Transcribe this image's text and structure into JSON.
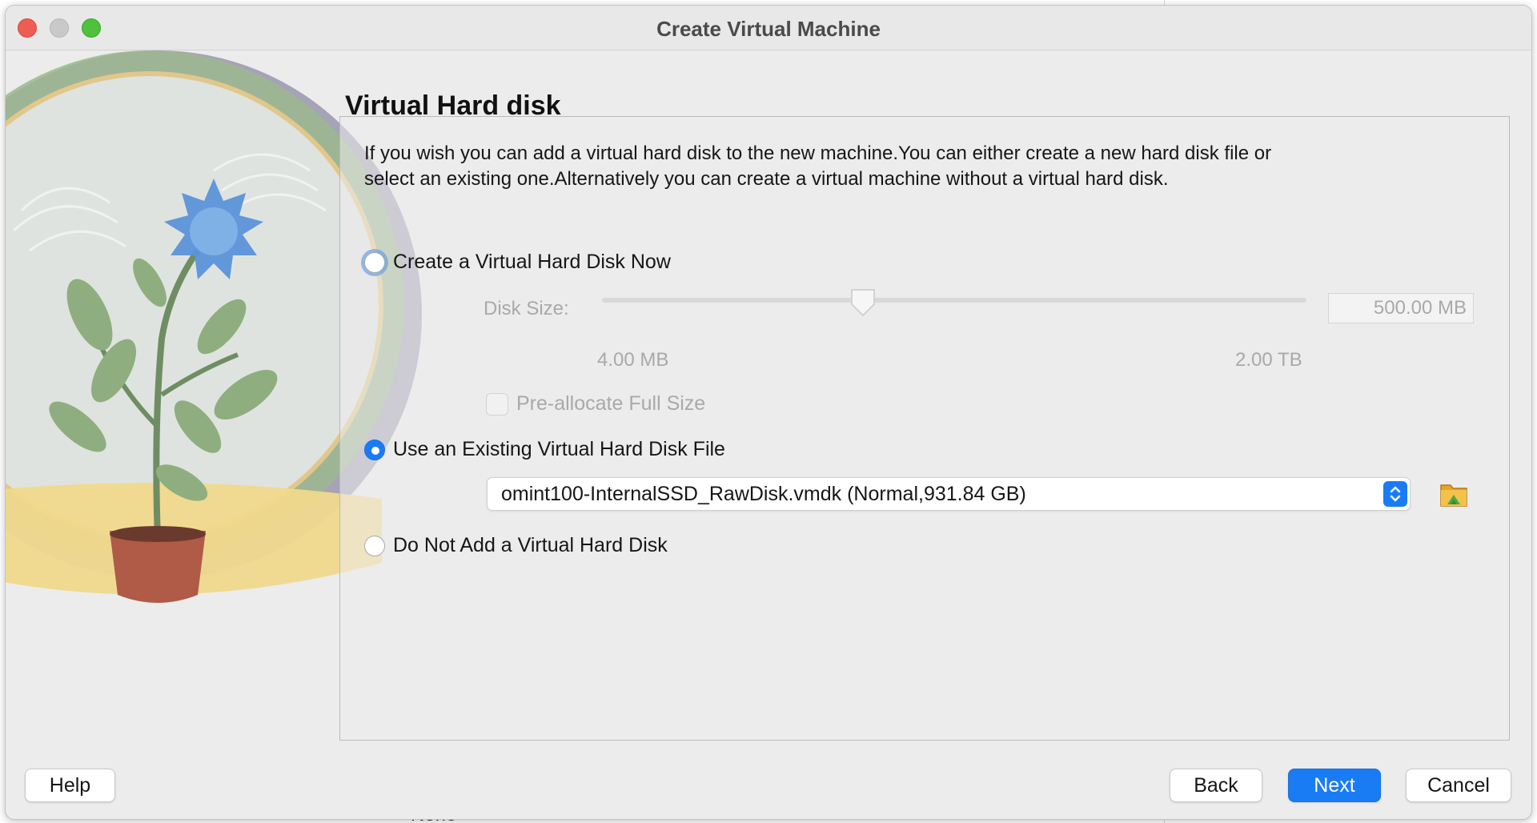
{
  "window": {
    "title": "Create Virtual Machine"
  },
  "page": {
    "heading": "Virtual Hard disk",
    "description": "If you wish you can add a virtual hard disk to the new machine.You can either create a new hard disk file or select an existing one.Alternatively you can create a virtual machine without a virtual hard disk."
  },
  "options": {
    "create_new": {
      "label": "Create a Virtual Hard Disk Now",
      "selected": false
    },
    "use_existing": {
      "label": "Use an Existing Virtual Hard Disk File",
      "selected": true
    },
    "no_disk": {
      "label": "Do Not Add a Virtual Hard Disk",
      "selected": false
    }
  },
  "disk_size": {
    "label": "Disk Size:",
    "value": "500.00 MB",
    "min_label": "4.00 MB",
    "max_label": "2.00 TB",
    "slider_fraction": 0.37
  },
  "preallocate": {
    "label": "Pre-allocate Full Size",
    "checked": false
  },
  "existing_disk": {
    "selected": "omint100-InternalSSD_RawDisk.vmdk (Normal,931.84 GB)"
  },
  "buttons": {
    "help": "Help",
    "back": "Back",
    "next": "Next",
    "cancel": "Cancel"
  },
  "background": {
    "partial_text": "None"
  },
  "colors": {
    "accent": "#1a7cf5",
    "close": "#ee5d53",
    "zoom": "#4fc13d"
  },
  "icons": [
    "folder-open-icon",
    "up-down-arrows-icon"
  ]
}
